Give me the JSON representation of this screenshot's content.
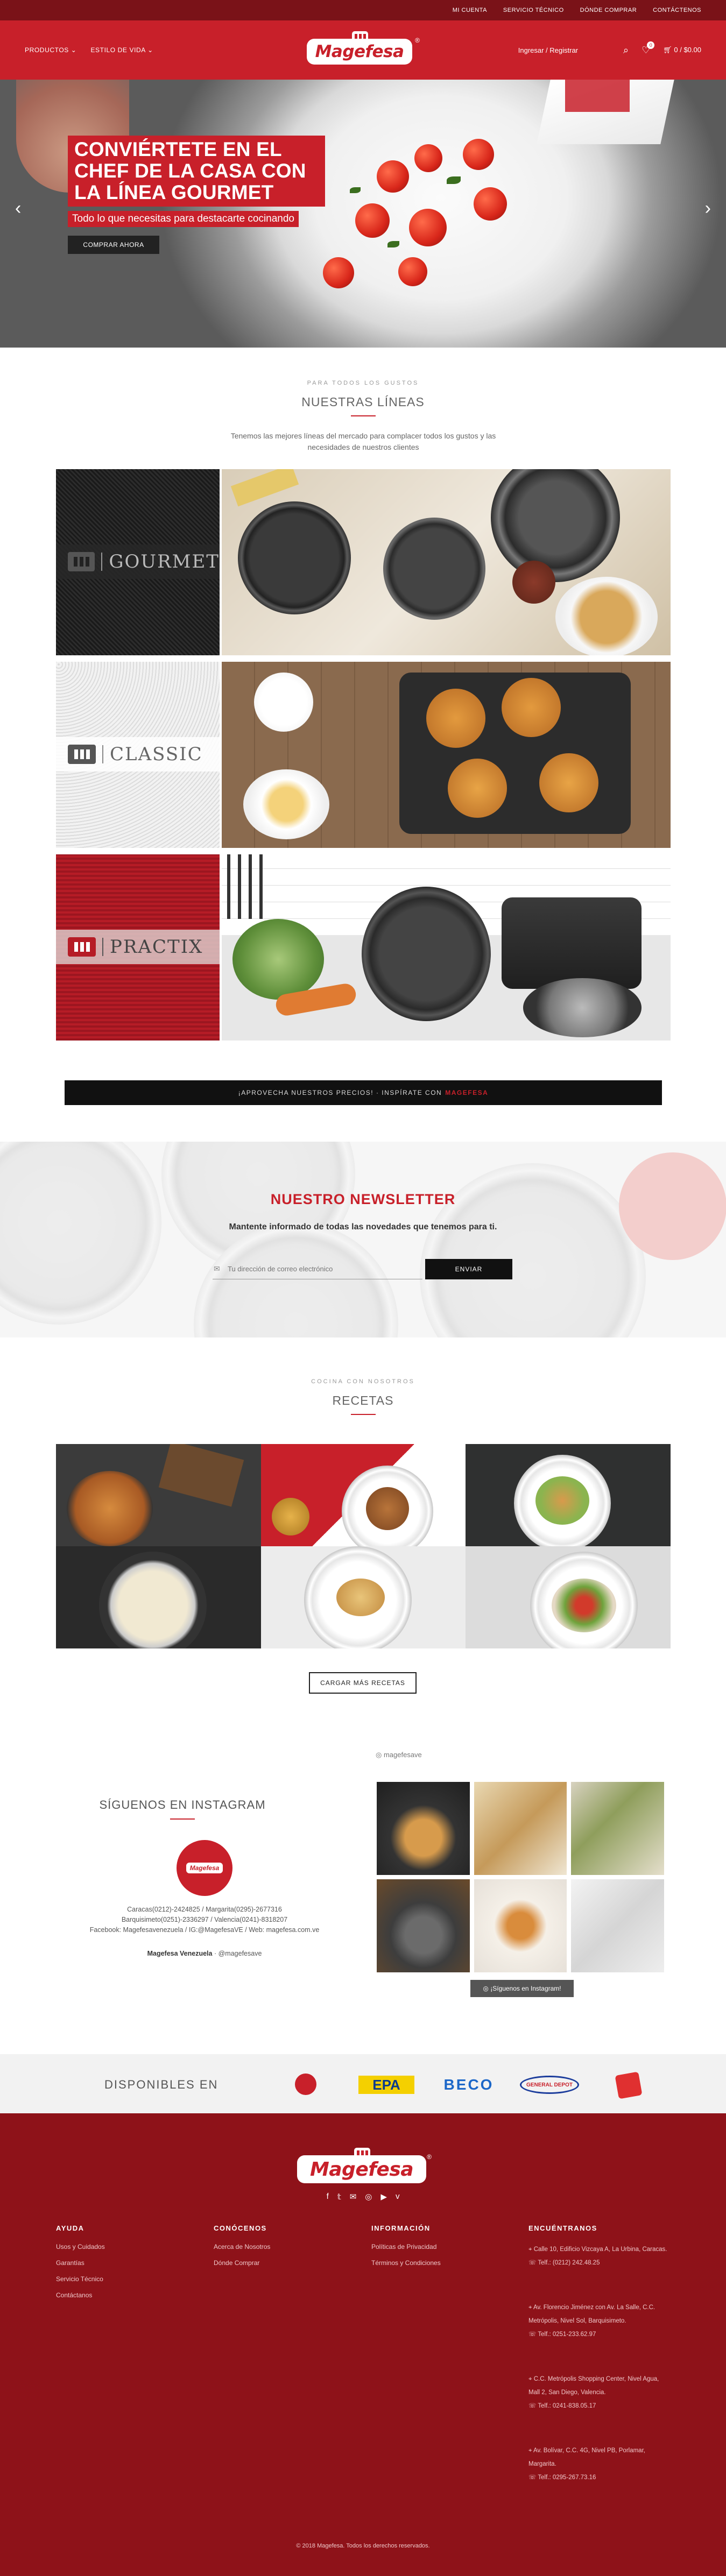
{
  "topbar": {
    "links": [
      "MI CUENTA",
      "SERVICIO TÉCNICO",
      "DÓNDE COMPRAR",
      "CONTÁCTENOS"
    ]
  },
  "nav": {
    "menu": [
      "PRODUCTOS ⌄",
      "ESTILO DE VIDA ⌄"
    ],
    "brand": "Magefesa",
    "login": "Ingresar / Registrar",
    "wishlist_count": "0",
    "cart": "0 / $0.00"
  },
  "hero": {
    "title": "CONVIÉRTETE EN EL CHEF DE LA CASA CON LA LÍNEA GOURMET",
    "subtitle": "Todo lo que necesitas para destacarte cocinando",
    "button": "COMPRAR AHORA"
  },
  "lines_section": {
    "kicker": "PARA TODOS LOS GUSTOS",
    "title": "NUESTRAS LÍNEAS",
    "description": "Tenemos las mejores líneas del mercado para complacer todos los gustos y las necesidades de nuestros clientes",
    "lines": [
      {
        "name": "GOURMET"
      },
      {
        "name": "CLASSIC"
      },
      {
        "name": "PRACTIX"
      }
    ]
  },
  "promo": {
    "text": "¡APROVECHA NUESTROS PRECIOS! · INSPÍRATE CON",
    "brand": "MAGEFESA"
  },
  "newsletter": {
    "title": "NUESTRO NEWSLETTER",
    "subtitle": "Mantente informado de todas las novedades que tenemos para ti.",
    "placeholder": "Tu dirección de correo electrónico",
    "button": "ENVIAR"
  },
  "recipes": {
    "kicker": "COCINA CON NOSOTROS",
    "title": "RECETAS",
    "button": "CARGAR MÁS RECETAS"
  },
  "instagram": {
    "title": "SÍGUENOS EN INSTAGRAM",
    "avatar_text": "Magefesa",
    "info_lines": [
      "Caracas(0212)-2424825 / Margarita(0295)-2677316",
      "Barquisimeto(0251)-2336297 / Valencia(0241)-8318207",
      "Facebook: Magefesavenezuela / IG:@MagefesaVE / Web: magefesa.com.ve"
    ],
    "account_name": "Magefesa Venezuela",
    "account_handle": "· @magefesave",
    "feed_user": "magefesave",
    "feed_button": "¡Síguenos en Instagram!"
  },
  "available": {
    "label": "DISPONIBLES EN",
    "stores": [
      "EPA",
      "BECO",
      "GENERAL DEPOT"
    ]
  },
  "footer": {
    "columns": [
      {
        "title": "AYUDA",
        "links": [
          "Usos y Cuidados",
          "Garantías",
          "Servicio Técnico",
          "Contáctanos"
        ]
      },
      {
        "title": "CONÓCENOS",
        "links": [
          "Acerca de Nosotros",
          "Dónde Comprar"
        ]
      },
      {
        "title": "INFORMACIÓN",
        "links": [
          "Políticas de Privacidad",
          "Términos y Condiciones"
        ]
      }
    ],
    "locations_title": "ENCUÉNTRANOS",
    "locations": [
      {
        "address": "Calle 10, Edificio Vizcaya A, La Urbina, Caracas.",
        "phone": "Telf.: (0212) 242.48.25"
      },
      {
        "address": "Av. Florencio Jiménez con Av. La Salle, C.C. Metrópolis, Nivel Sol, Barquisimeto.",
        "phone": "Telf.: 0251-233.62.97"
      },
      {
        "address": "C.C. Metrópolis Shopping Center, Nivel Agua, Mall 2, San Diego, Valencia.",
        "phone": "Telf.: 0241-838.05.17"
      },
      {
        "address": "Av. Bolívar, C.C. 4G, Nivel PB, Porlamar, Margarita.",
        "phone": "Telf.: 0295-267.73.16"
      }
    ],
    "copyright": "© 2018 Magefesa. Todos los derechos reservados."
  },
  "colors": {
    "brand_red": "#c8202a",
    "dark_red": "#7a1218",
    "footer_red": "#8e1219"
  }
}
